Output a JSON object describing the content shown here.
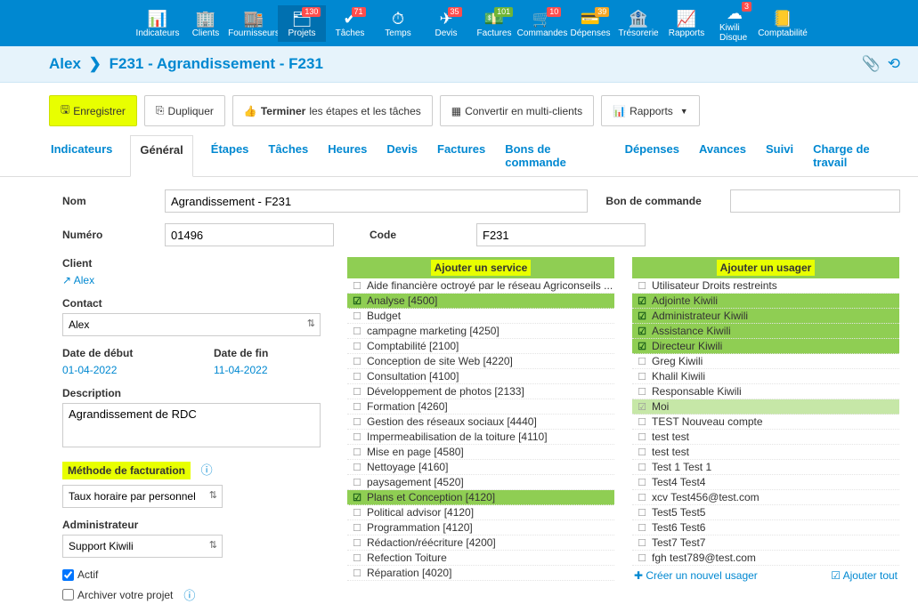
{
  "nav": [
    {
      "key": "indicateurs",
      "label": "Indicateurs",
      "badge": null,
      "badgeClass": ""
    },
    {
      "key": "clients",
      "label": "Clients",
      "badge": null,
      "badgeClass": ""
    },
    {
      "key": "fournisseurs",
      "label": "Fournisseurs",
      "badge": null,
      "badgeClass": ""
    },
    {
      "key": "projets",
      "label": "Projets",
      "badge": "130",
      "badgeClass": "",
      "active": true
    },
    {
      "key": "taches",
      "label": "Tâches",
      "badge": "71",
      "badgeClass": ""
    },
    {
      "key": "temps",
      "label": "Temps",
      "badge": null,
      "badgeClass": ""
    },
    {
      "key": "devis",
      "label": "Devis",
      "badge": "35",
      "badgeClass": ""
    },
    {
      "key": "factures",
      "label": "Factures",
      "badge": "101",
      "badgeClass": "green"
    },
    {
      "key": "commandes",
      "label": "Commandes",
      "badge": "10",
      "badgeClass": ""
    },
    {
      "key": "depenses",
      "label": "Dépenses",
      "badge": "39",
      "badgeClass": "orange"
    },
    {
      "key": "tresorerie",
      "label": "Trésorerie",
      "badge": null,
      "badgeClass": ""
    },
    {
      "key": "rapports",
      "label": "Rapports",
      "badge": null,
      "badgeClass": ""
    },
    {
      "key": "kiwili-disque",
      "label": "Kiwili Disque",
      "badge": "3",
      "badgeClass": ""
    },
    {
      "key": "comptabilite",
      "label": "Comptabilité",
      "badge": null,
      "badgeClass": ""
    }
  ],
  "breadcrumb": {
    "client": "Alex",
    "title": "F231 - Agrandissement - F231"
  },
  "toolbar": {
    "save": "Enregistrer",
    "dup": "Dupliquer",
    "finish_pre": "Terminer",
    "finish_rest": " les étapes et les tâches",
    "convert": "Convertir en multi-clients",
    "reports": "Rapports"
  },
  "tabs": [
    "Indicateurs",
    "Général",
    "Étapes",
    "Tâches",
    "Heures",
    "Devis",
    "Factures",
    "Bons de commande",
    "Dépenses",
    "Avances",
    "Suivi",
    "Charge de travail"
  ],
  "active_tab": "Général",
  "labels": {
    "nom": "Nom",
    "numero": "Numéro",
    "code": "Code",
    "bon": "Bon de commande",
    "client": "Client",
    "contact": "Contact",
    "date_debut": "Date de début",
    "date_fin": "Date de fin",
    "description": "Description",
    "methode": "Méthode de facturation",
    "admin": "Administrateur",
    "actif": "Actif",
    "archiver": "Archiver votre projet"
  },
  "values": {
    "nom": "Agrandissement - F231",
    "numero": "01496",
    "code": "F231",
    "bon": "",
    "client_link": "Alex",
    "contact": "Alex",
    "date_debut": "01-04-2022",
    "date_fin": "11-04-2022",
    "description": "Agrandissement de RDC",
    "methode": "Taux horaire par personnel",
    "admin": "Support Kiwili",
    "actif": true,
    "archiver": false
  },
  "services": {
    "head": "Ajouter un service",
    "items": [
      {
        "label": "Aide financière octroyé par le réseau Agriconseils ...",
        "sel": false
      },
      {
        "label": "Analyse [4500]",
        "sel": true
      },
      {
        "label": "Budget",
        "sel": false
      },
      {
        "label": "campagne marketing [4250]",
        "sel": false
      },
      {
        "label": "Comptabilité [2100]",
        "sel": false
      },
      {
        "label": "Conception de site Web [4220]",
        "sel": false
      },
      {
        "label": "Consultation [4100]",
        "sel": false
      },
      {
        "label": "Développement de photos [2133]",
        "sel": false
      },
      {
        "label": "Formation [4260]",
        "sel": false
      },
      {
        "label": "Gestion des réseaux sociaux [4440]",
        "sel": false
      },
      {
        "label": "Impermeabilisation de la toiture [4110]",
        "sel": false
      },
      {
        "label": "Mise en page [4580]",
        "sel": false
      },
      {
        "label": "Nettoyage [4160]",
        "sel": false
      },
      {
        "label": "paysagement [4520]",
        "sel": false
      },
      {
        "label": "Plans et Conception [4120]",
        "sel": true
      },
      {
        "label": "Political advisor [4120]",
        "sel": false
      },
      {
        "label": "Programmation [4120]",
        "sel": false
      },
      {
        "label": "Rédaction/réécriture [4200]",
        "sel": false
      },
      {
        "label": "Refection Toiture",
        "sel": false
      },
      {
        "label": "Réparation [4020]",
        "sel": false
      }
    ]
  },
  "users": {
    "head": "Ajouter un usager",
    "items": [
      {
        "label": "Utilisateur Droits restreints",
        "sel": false
      },
      {
        "label": "Adjointe Kiwili",
        "sel": true
      },
      {
        "label": "Administrateur Kiwili",
        "sel": true
      },
      {
        "label": "Assistance Kiwili",
        "sel": true
      },
      {
        "label": "Directeur Kiwili",
        "sel": true
      },
      {
        "label": "Greg Kiwili",
        "sel": false
      },
      {
        "label": "Khalil Kiwili",
        "sel": false
      },
      {
        "label": "Responsable Kiwili",
        "sel": false
      },
      {
        "label": "Moi",
        "sel": true,
        "me": true
      },
      {
        "label": "TEST Nouveau compte",
        "sel": false
      },
      {
        "label": "test test",
        "sel": false
      },
      {
        "label": "test test",
        "sel": false
      },
      {
        "label": "Test 1 Test 1",
        "sel": false
      },
      {
        "label": "Test4 Test4",
        "sel": false
      },
      {
        "label": "xcv Test456@test.com",
        "sel": false
      },
      {
        "label": "Test5 Test5",
        "sel": false
      },
      {
        "label": "Test6 Test6",
        "sel": false
      },
      {
        "label": "Test7 Test7",
        "sel": false
      },
      {
        "label": "fgh test789@test.com",
        "sel": false
      }
    ],
    "create": "Créer un nouvel usager",
    "add_all": "Ajouter tout"
  }
}
